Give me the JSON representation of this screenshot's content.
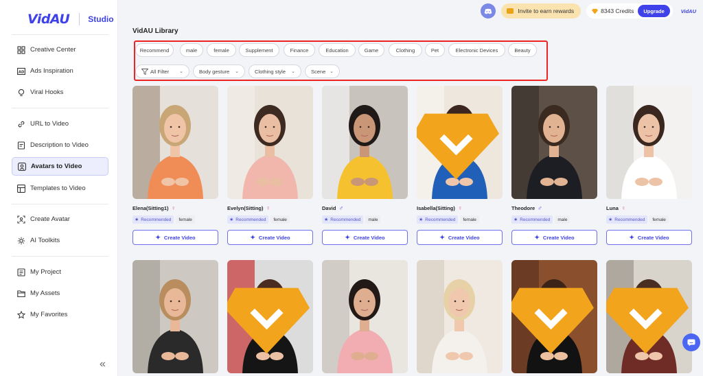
{
  "brand": {
    "logo": "VidAU",
    "product": "Studio"
  },
  "sidebar": {
    "items": [
      {
        "label": "Creative Center",
        "icon": "grid-icon"
      },
      {
        "label": "Ads Inspiration",
        "icon": "ad-icon"
      },
      {
        "label": "Viral Hooks",
        "icon": "lightbulb-icon"
      },
      {
        "label": "URL to Video",
        "icon": "link-icon"
      },
      {
        "label": "Description to Video",
        "icon": "document-icon"
      },
      {
        "label": "Avatars to Video",
        "icon": "avatar-icon",
        "active": true
      },
      {
        "label": "Templates to Video",
        "icon": "template-icon"
      },
      {
        "label": "Create Avatar",
        "icon": "create-avatar-icon"
      },
      {
        "label": "AI Toolkits",
        "icon": "sparkle-icon"
      },
      {
        "label": "My Project",
        "icon": "project-icon"
      },
      {
        "label": "My Assets",
        "icon": "folder-icon"
      },
      {
        "label": "My Favorites",
        "icon": "star-icon"
      }
    ],
    "collapse_label": "«"
  },
  "topbar": {
    "invite_label": "Invite to earn rewards",
    "credits_label": "8343 Credits",
    "upgrade_label": "Upgrade",
    "mini_logo": "VidAU"
  },
  "library": {
    "title": "VidAU Library",
    "category_chips": [
      "Recommend",
      "male",
      "female",
      "Supplement",
      "Finance",
      "Education",
      "Game",
      "Clothing",
      "Pet",
      "Electronic Devices",
      "Beauty"
    ],
    "filter_dropdowns": [
      "All Filter",
      "Body gesture",
      "Clothing style",
      "Scene"
    ],
    "chevron": "⌄",
    "cards": [
      {
        "name": "Elena(Sitting1)",
        "gender": "female",
        "gender_symbol": "♀",
        "tag": "Recommended",
        "premium": false
      },
      {
        "name": "Evelyn(Sitting)",
        "gender": "female",
        "gender_symbol": "♀",
        "tag": "Recommended",
        "premium": false
      },
      {
        "name": "David",
        "gender": "male",
        "gender_symbol": "♂",
        "tag": "Recommended",
        "premium": false
      },
      {
        "name": "Isabella(Sitting)",
        "gender": "female",
        "gender_symbol": "♀",
        "tag": "Recommended",
        "premium": true
      },
      {
        "name": "Theodore",
        "gender": "male",
        "gender_symbol": "♂",
        "tag": "Recommended",
        "premium": false
      },
      {
        "name": "Luna",
        "gender": "female",
        "gender_symbol": "♀",
        "tag": "Recommended",
        "premium": false
      }
    ],
    "row2_premium": [
      false,
      true,
      false,
      false,
      true,
      true
    ],
    "create_label": "Create Video"
  },
  "colors": {
    "accent": "#3f42e8",
    "highlight_box": "#e22222",
    "female": "#e05aa6"
  }
}
